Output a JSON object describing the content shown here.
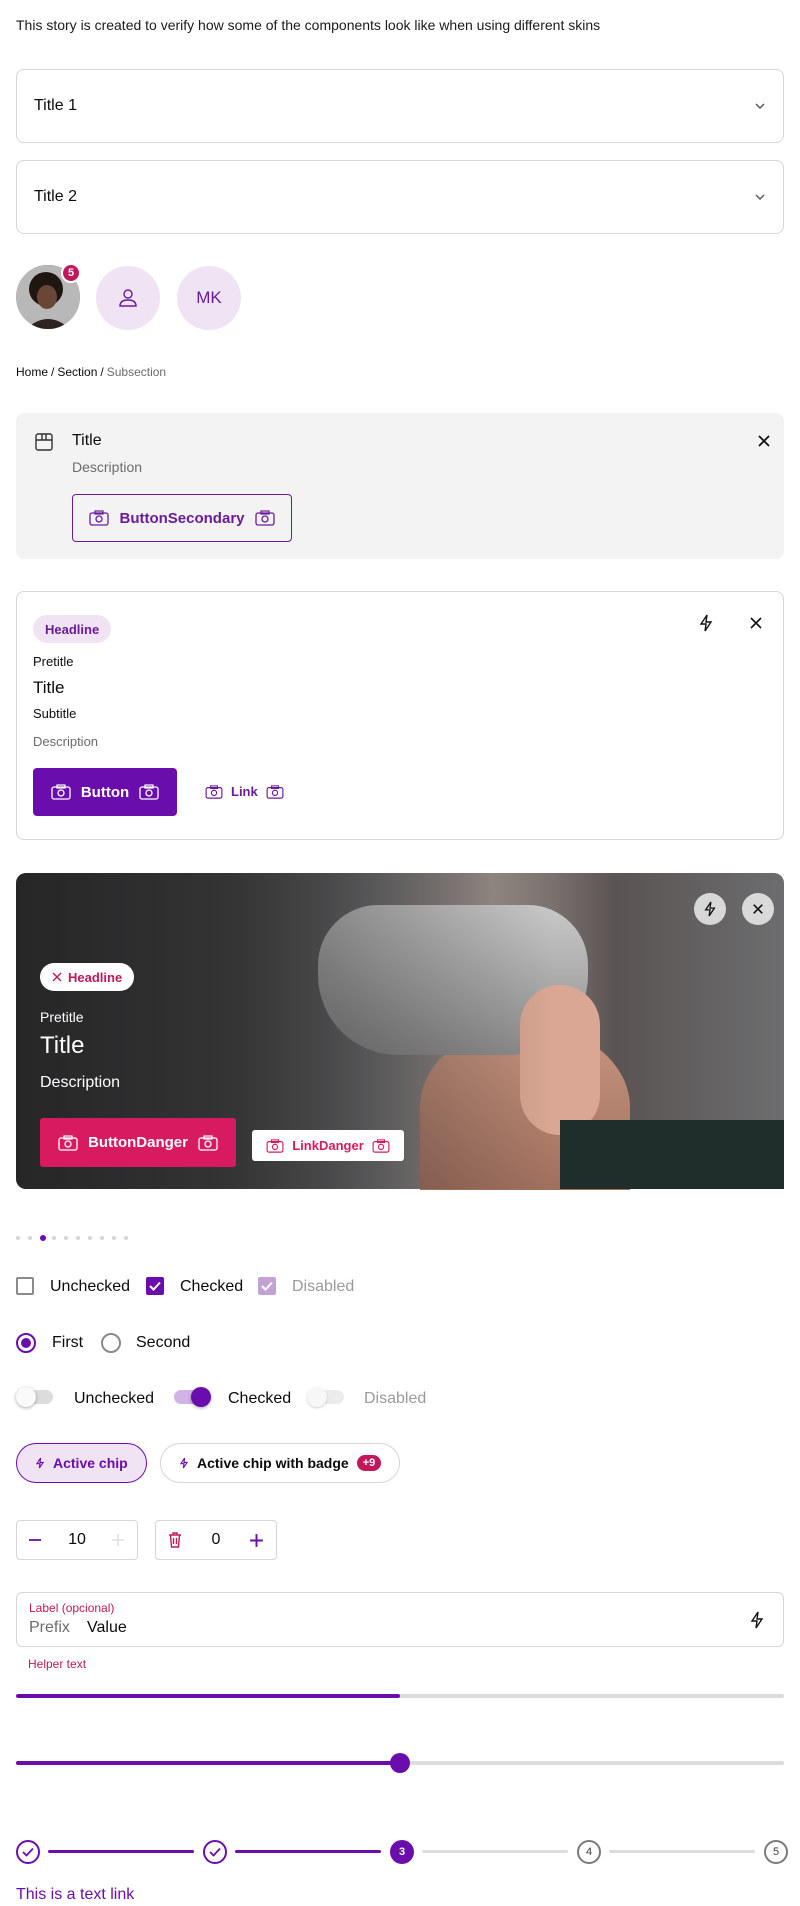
{
  "intro": "This story is created to verify how some of the components look like when using different skins",
  "accordions": [
    {
      "title": "Title 1"
    },
    {
      "title": "Title 2"
    }
  ],
  "avatars": {
    "badge_count": "5",
    "initials": "MK"
  },
  "breadcrumb": {
    "items": [
      "Home",
      "Section"
    ],
    "separator": "/",
    "current": "Subsection"
  },
  "callout": {
    "title": "Title",
    "description": "Description",
    "button_label": "ButtonSecondary"
  },
  "card": {
    "headline": "Headline",
    "pretitle": "Pretitle",
    "title": "Title",
    "subtitle": "Subtitle",
    "description": "Description",
    "button_label": "Button",
    "link_label": "Link"
  },
  "hero": {
    "headline": "Headline",
    "pretitle": "Pretitle",
    "title": "Title",
    "description": "Description",
    "button_label": "ButtonDanger",
    "link_label": "LinkDanger"
  },
  "pagination": {
    "total": 10,
    "active_index": 2
  },
  "checkboxes": [
    {
      "label": "Unchecked",
      "checked": false,
      "disabled": false
    },
    {
      "label": "Checked",
      "checked": true,
      "disabled": false
    },
    {
      "label": "Disabled",
      "checked": true,
      "disabled": true
    }
  ],
  "radios": [
    {
      "label": "First",
      "selected": true
    },
    {
      "label": "Second",
      "selected": false
    }
  ],
  "switches": [
    {
      "label": "Unchecked",
      "on": false,
      "disabled": false
    },
    {
      "label": "Checked",
      "on": true,
      "disabled": false
    },
    {
      "label": "Disabled",
      "on": false,
      "disabled": true
    }
  ],
  "chips": {
    "active_label": "Active chip",
    "badge_chip_label": "Active chip with badge",
    "badge_value": "+9"
  },
  "steppers": [
    {
      "value": "10"
    },
    {
      "value": "0"
    }
  ],
  "text_field": {
    "label": "Label (opcional)",
    "prefix": "Prefix",
    "value": "Value",
    "helper": "Helper text"
  },
  "progress": {
    "value_percent": 50
  },
  "slider": {
    "value_percent": 50
  },
  "step_indicator": {
    "steps": [
      "1",
      "2",
      "3",
      "4",
      "5"
    ],
    "current": 3
  },
  "text_link": "This is a text link",
  "colors": {
    "accent": "#6a0dad",
    "danger": "#d81b60",
    "badge": "#c2185b",
    "chip_bg": "#f0e3f3"
  }
}
